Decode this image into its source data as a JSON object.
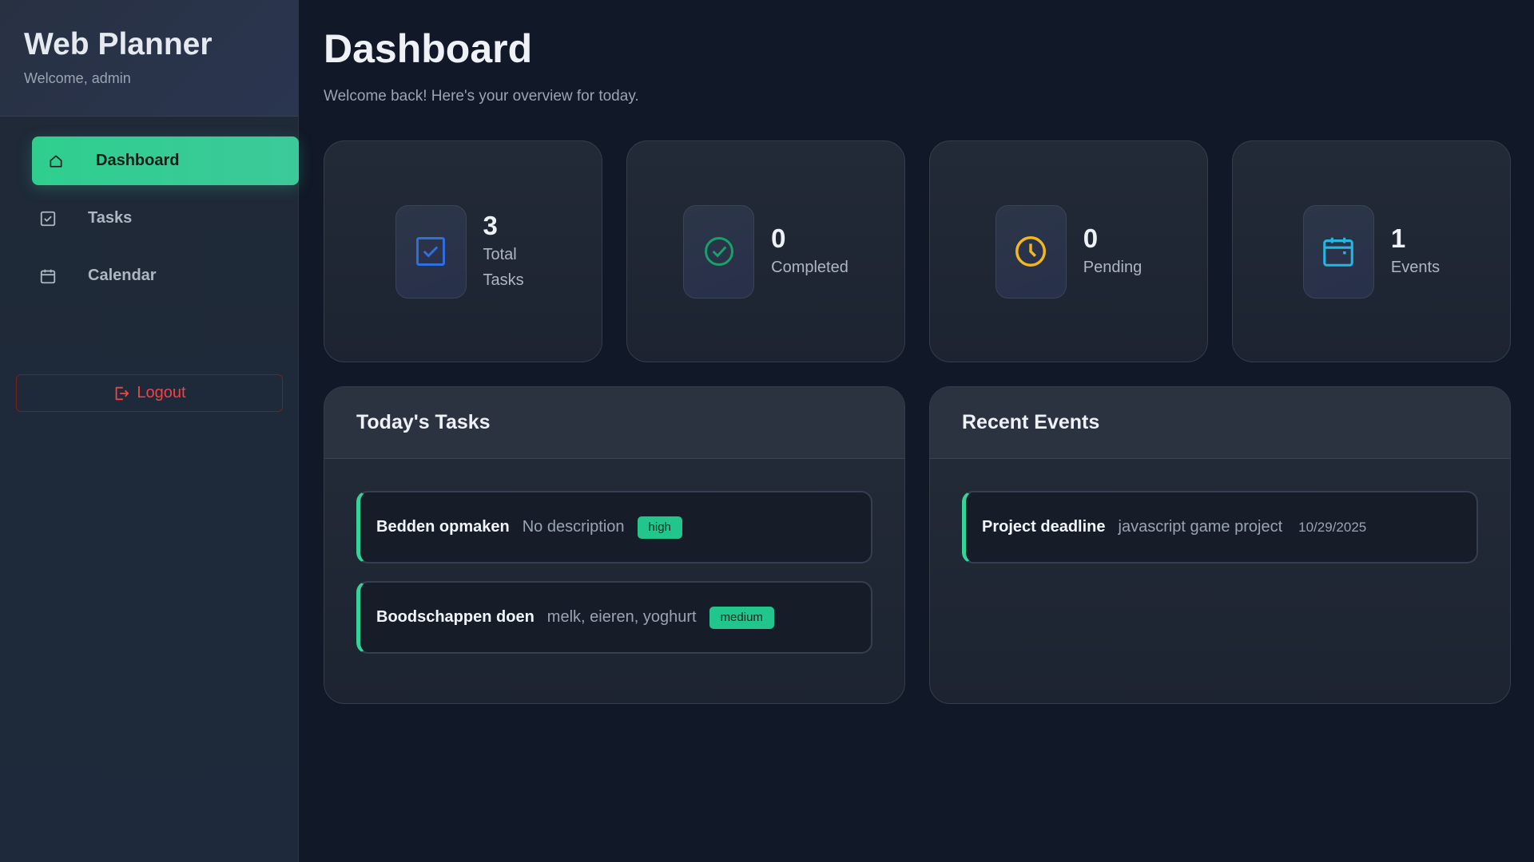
{
  "sidebar": {
    "title": "Web Planner",
    "welcome": "Welcome, admin",
    "items": [
      {
        "label": "Dashboard",
        "icon": "home-icon",
        "active": true
      },
      {
        "label": "Tasks",
        "icon": "checkbox-icon",
        "active": false
      },
      {
        "label": "Calendar",
        "icon": "calendar-icon",
        "active": false
      }
    ],
    "logout_label": "Logout"
  },
  "header": {
    "title": "Dashboard",
    "subtitle": "Welcome back! Here's your overview for today."
  },
  "stats": [
    {
      "value": "3",
      "label": "Total Tasks",
      "icon": "checkbox-icon",
      "color": "#2f6fe0"
    },
    {
      "value": "0",
      "label": "Completed",
      "icon": "check-circle-icon",
      "color": "#16a36a"
    },
    {
      "value": "0",
      "label": "Pending",
      "icon": "clock-icon",
      "color": "#f5b81c"
    },
    {
      "value": "1",
      "label": "Events",
      "icon": "calendar-icon",
      "color": "#22b8e6"
    }
  ],
  "tasks_panel": {
    "title": "Today's Tasks",
    "items": [
      {
        "title": "Bedden opmaken",
        "description": "No description",
        "priority": "high"
      },
      {
        "title": "Boodschappen doen",
        "description": "melk, eieren, yoghurt",
        "priority": "medium"
      }
    ]
  },
  "events_panel": {
    "title": "Recent Events",
    "items": [
      {
        "title": "Project deadline",
        "description": "javascript game project",
        "date": "10/29/2025"
      }
    ]
  },
  "colors": {
    "accent": "#34d399",
    "danger": "#ef4444",
    "background": "#111827"
  }
}
